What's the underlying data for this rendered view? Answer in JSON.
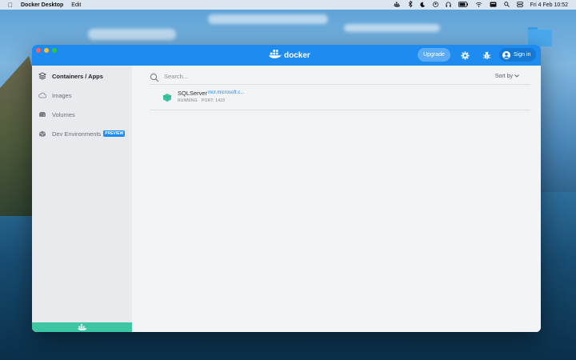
{
  "menubar": {
    "app_name": "Docker Desktop",
    "menu_edit": "Edit",
    "clock": "Fri 4 Feb  10:52"
  },
  "window": {
    "logo_text": "docker",
    "upgrade_label": "Upgrade",
    "signin_label": "Sign in"
  },
  "sidebar": {
    "items": [
      {
        "label": "Containers / Apps",
        "icon": "stack-icon",
        "active": true
      },
      {
        "label": "Images",
        "icon": "cloud-icon",
        "active": false
      },
      {
        "label": "Volumes",
        "icon": "disk-icon",
        "active": false
      },
      {
        "label": "Dev Environments",
        "icon": "cube-icon",
        "active": false
      }
    ],
    "preview_badge": "PREVIEW"
  },
  "search": {
    "placeholder": "Search...",
    "value": ""
  },
  "sort_label": "Sort by",
  "containers": [
    {
      "name": "SQLServer",
      "image": "mcr.microsoft.c...",
      "status": "RUNNING",
      "port": "PORT: 1433"
    }
  ],
  "colors": {
    "accent": "#1d8bf0",
    "container_green": "#3cc7a2"
  }
}
